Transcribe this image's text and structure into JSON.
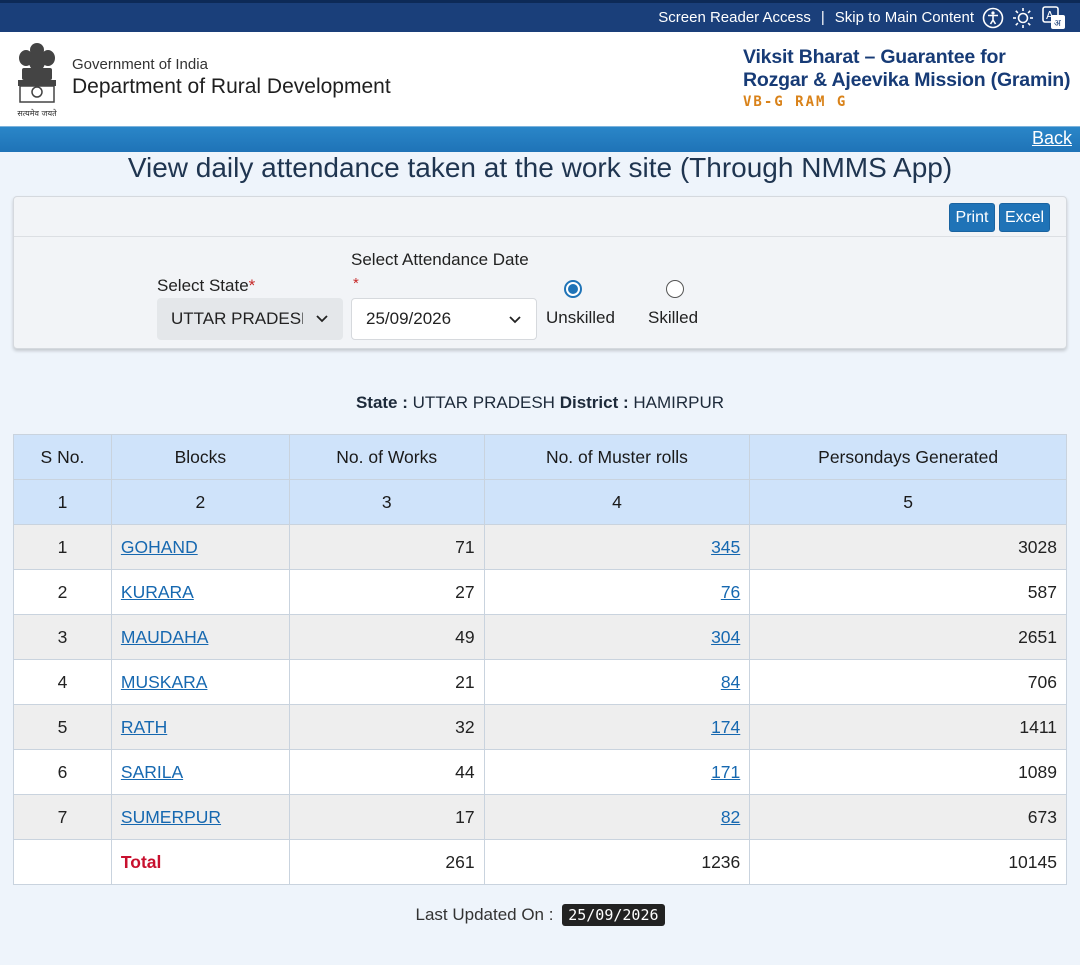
{
  "topbar": {
    "screen_reader": "Screen Reader Access",
    "separator": "|",
    "skip_main": "Skip to Main Content",
    "icons": [
      "accessibility-icon",
      "brightness-icon",
      "translate-icon"
    ]
  },
  "header": {
    "gov": "Government of India",
    "dept": "Department of Rural Development",
    "emblem_caption": "सत्यमेव जयते",
    "mission_title": "Viksit Bharat – Guarantee for Rozgar & Ajeevika Mission (Gramin)",
    "mission_sub": "VB-G RAM G"
  },
  "nav": {
    "back": "Back"
  },
  "page": {
    "title": "View daily attendance taken at the work site (Through NMMS App)"
  },
  "filters": {
    "print": "Print",
    "excel": "Excel",
    "state_label": "Select State",
    "date_label": "Select Attendance Date",
    "required_mark": "*",
    "state_value": "UTTAR PRADESH",
    "date_value": "25/09/2026",
    "radio_unskilled": "Unskilled",
    "radio_skilled": "Skilled",
    "selected_radio": "Unskilled"
  },
  "summary": {
    "state_key": "State :",
    "state_value": "UTTAR PRADESH",
    "district_key": "District :",
    "district_value": "HAMIRPUR"
  },
  "table": {
    "headers": [
      "S No.",
      "Blocks",
      "No. of Works",
      "No. of Muster rolls",
      "Persondays Generated"
    ],
    "col_numbers": [
      "1",
      "2",
      "3",
      "4",
      "5"
    ],
    "rows": [
      {
        "sno": "1",
        "block": "GOHAND",
        "works": "71",
        "muster": "345",
        "persondays": "3028"
      },
      {
        "sno": "2",
        "block": "KURARA",
        "works": "27",
        "muster": "76",
        "persondays": "587"
      },
      {
        "sno": "3",
        "block": "MAUDAHA",
        "works": "49",
        "muster": "304",
        "persondays": "2651"
      },
      {
        "sno": "4",
        "block": "MUSKARA",
        "works": "21",
        "muster": "84",
        "persondays": "706"
      },
      {
        "sno": "5",
        "block": "RATH",
        "works": "32",
        "muster": "174",
        "persondays": "1411"
      },
      {
        "sno": "6",
        "block": "SARILA",
        "works": "44",
        "muster": "171",
        "persondays": "1089"
      },
      {
        "sno": "7",
        "block": "SUMERPUR",
        "works": "17",
        "muster": "82",
        "persondays": "673"
      }
    ],
    "total": {
      "label": "Total",
      "works": "261",
      "muster": "1236",
      "persondays": "10145"
    }
  },
  "footer": {
    "last_updated_label": "Last Updated On :",
    "last_updated_value": "25/09/2026"
  }
}
